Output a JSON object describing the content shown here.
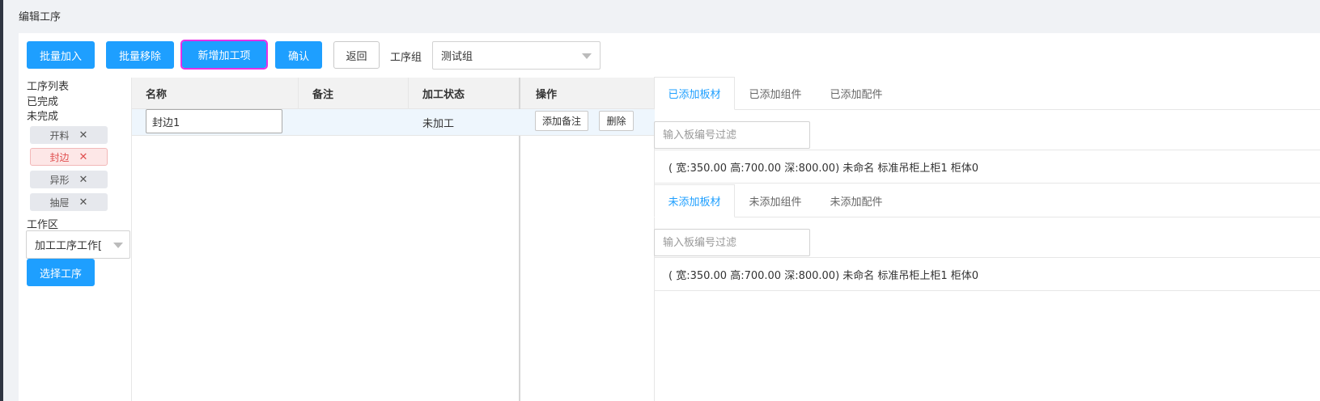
{
  "page": {
    "title": "编辑工序"
  },
  "toolbar": {
    "batch_add": "批量加入",
    "batch_remove": "批量移除",
    "add_process_item": "新增加工项",
    "confirm": "确认",
    "back": "返回",
    "group_label": "工序组",
    "group_value": "测试组"
  },
  "sidebar": {
    "process_list": "工序列表",
    "completed": "已完成",
    "uncompleted": "未完成",
    "tags": [
      {
        "label": "开料",
        "active": false
      },
      {
        "label": "封边",
        "active": true
      },
      {
        "label": "异形",
        "active": false
      },
      {
        "label": "抽屉",
        "active": false
      }
    ],
    "workspace_label": "工作区",
    "workspace_value": "加工工序工作[",
    "select_process": "选择工序"
  },
  "table": {
    "headers": [
      "名称",
      "备注",
      "加工状态",
      "操作"
    ],
    "rows": [
      {
        "name": "封边1",
        "note": "",
        "status": "未加工",
        "add_note": "添加备注",
        "delete": "删除"
      }
    ]
  },
  "added": {
    "tabs": [
      "已添加板材",
      "已添加组件",
      "已添加配件"
    ],
    "active_tab": 0,
    "filter_placeholder": "输入板编号过滤",
    "items": [
      "( 宽:350.00 高:700.00 深:800.00) 未命名 标准吊柜上柜1 柜体0"
    ]
  },
  "not_added": {
    "tabs": [
      "未添加板材",
      "未添加组件",
      "未添加配件"
    ],
    "active_tab": 0,
    "filter_placeholder": "输入板编号过滤",
    "items": [
      "( 宽:350.00 高:700.00 深:800.00) 未命名 标准吊柜上柜1 柜体0"
    ]
  },
  "colors": {
    "primary": "#1e9fff",
    "active_tag": "#e05050",
    "focus_outline": "#e62fe6"
  }
}
